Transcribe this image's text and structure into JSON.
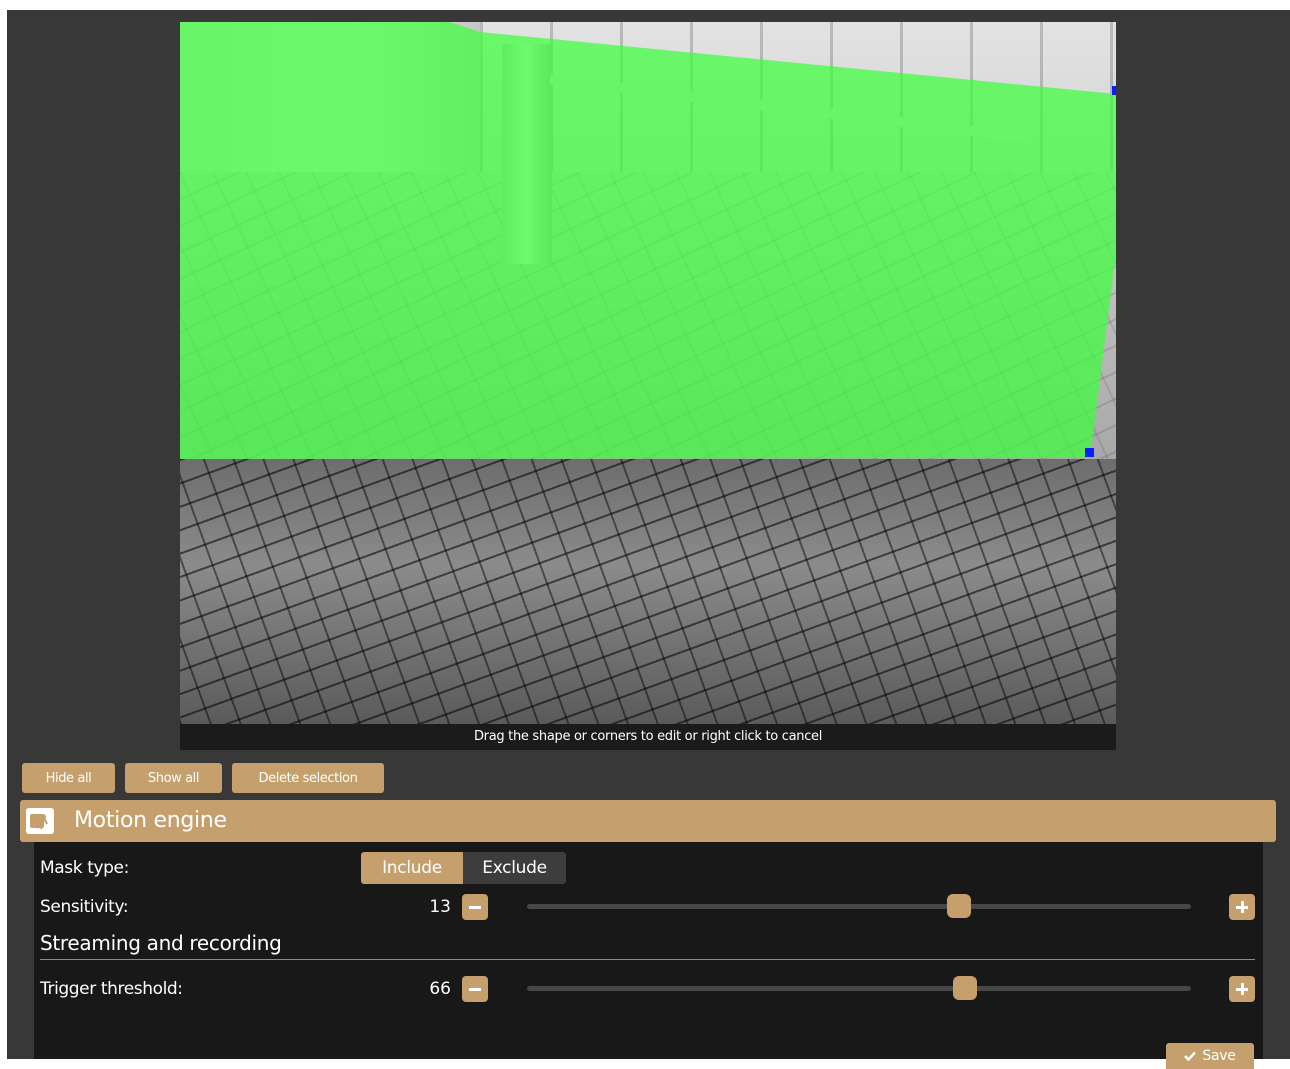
{
  "camera": {
    "caption": "Drag the shape or corners to edit or right click to cancel",
    "mask_color": "#3cff3c"
  },
  "toolbar": {
    "hide_all": "Hide all",
    "show_all": "Show all",
    "delete_selection": "Delete selection"
  },
  "panel": {
    "title": "Motion engine",
    "icon": "motion-engine-icon",
    "accent": "#c6a06c"
  },
  "mask_type": {
    "label": "Mask type:",
    "options": [
      "Include",
      "Exclude"
    ],
    "selected": "Include"
  },
  "sensitivity": {
    "label": "Sensitivity:",
    "value": "13",
    "slider_fraction": 0.65
  },
  "streaming": {
    "title": "Streaming and recording"
  },
  "trigger": {
    "label": "Trigger threshold:",
    "value": "66",
    "slider_fraction": 0.66
  },
  "save": {
    "label": "Save"
  }
}
